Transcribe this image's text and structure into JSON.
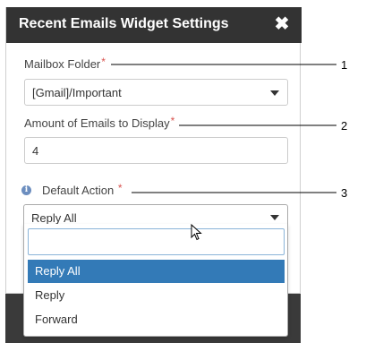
{
  "dialog": {
    "title": "Recent Emails Widget Settings",
    "close_glyph": "✖"
  },
  "fields": {
    "mailbox_folder": {
      "label": "Mailbox Folder",
      "required_mark": "*",
      "value": "[Gmail]/Important"
    },
    "amount": {
      "label": "Amount of Emails to Display",
      "required_mark": "*",
      "value": "4"
    },
    "default_action": {
      "label": "Default Action",
      "required_mark": "*",
      "info_glyph": "i",
      "value": "Reply All",
      "search_value": "",
      "options": [
        "Reply All",
        "Reply",
        "Forward"
      ]
    }
  },
  "callouts": [
    "1",
    "2",
    "3"
  ],
  "colors": {
    "header_bg": "#333333",
    "selected_option_bg": "#337ab7",
    "required": "#d9534f"
  }
}
